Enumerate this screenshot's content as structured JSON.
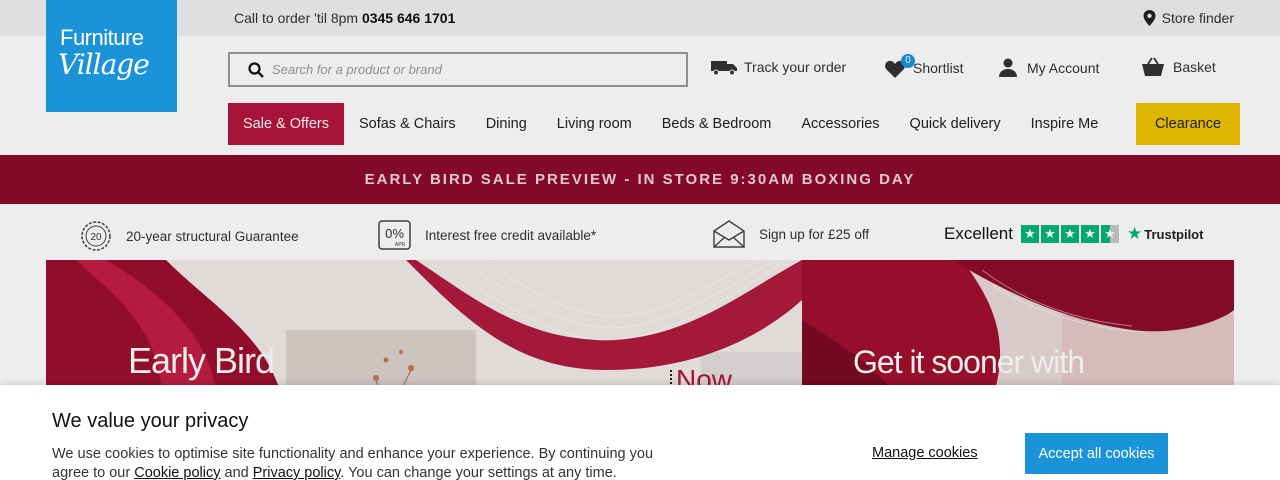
{
  "header": {
    "logo": {
      "line1": "Furniture",
      "line2": "Village"
    },
    "call_text": "Call to order 'til 8pm ",
    "phone": "0345 646 1701",
    "store_finder": "Store finder",
    "search_placeholder": "Search for a product or brand",
    "utility": {
      "track": "Track your order",
      "shortlist": "Shortlist",
      "shortlist_count": "0",
      "account": "My Account",
      "basket": "Basket"
    }
  },
  "nav": [
    "Sale & Offers",
    "Sofas & Chairs",
    "Dining",
    "Living room",
    "Beds & Bedroom",
    "Accessories",
    "Quick delivery",
    "Inspire Me",
    "Clearance"
  ],
  "promo_banner": "EARLY BIRD SALE PREVIEW - IN STORE 9:30AM BOXING DAY",
  "usps": [
    {
      "icon": "badge-20-icon",
      "badge": "20",
      "text": "20-year structural Guarantee"
    },
    {
      "icon": "zero-percent-icon",
      "badge": "0%",
      "sub": "APR",
      "text": "Interest free credit available*"
    },
    {
      "icon": "envelope-icon",
      "text": "Sign up for £25 off"
    }
  ],
  "trustpilot": {
    "rating_word": "Excellent",
    "brand": "Trustpilot",
    "stars": 4.5
  },
  "heroes": [
    {
      "headline": "Early Bird",
      "tag": "Now"
    },
    {
      "headline": "Get it sooner with"
    }
  ],
  "cookie": {
    "title": "We value your privacy",
    "text_1": "We use cookies to optimise site functionality and enhance your experience. By continuing you agree to our ",
    "cookie_policy": "Cookie policy",
    "and": " and ",
    "privacy_policy": "Privacy policy",
    "text_2": ". You can change your settings at any time.",
    "manage": "Manage cookies",
    "accept": "Accept all cookies"
  },
  "colors": {
    "brand_blue": "#1b93d8",
    "sale_red": "#b4153d",
    "banner_red": "#8d0a2e",
    "clearance_yellow": "#f2c500",
    "trustpilot_green": "#00b67a"
  }
}
